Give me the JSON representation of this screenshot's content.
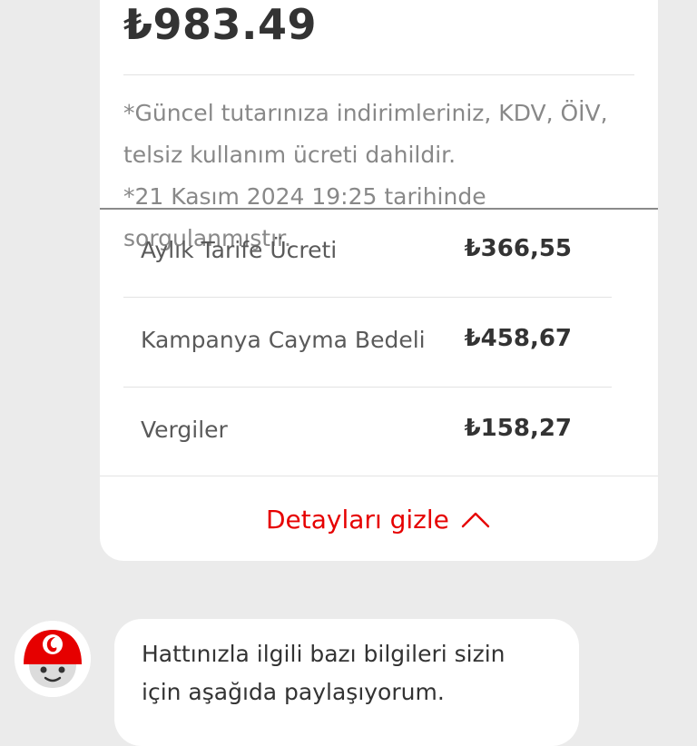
{
  "bill": {
    "total_amount": "₺983.49",
    "note_line1": "*Güncel tutarınıza indirimleriniz, KDV, ÖİV,",
    "note_line2": "telsiz kullanım ücreti dahildir.",
    "note_line3": "*21 Kasım 2024 19:25  tarihinde",
    "note_line4": "sorgulanmıştır."
  },
  "details": {
    "rows": [
      {
        "label": "Aylık Tarife Ücreti",
        "amount": "₺366,55"
      },
      {
        "label": "Kampanya Cayma Bedeli",
        "amount": "₺458,67"
      },
      {
        "label": "Vergiler",
        "amount": "₺158,27"
      }
    ],
    "toggle_label": "Detayları gizle"
  },
  "chat": {
    "message_line1": "Hattınızla ilgili bazı bilgileri sizin",
    "message_line2": "için aşağıda paylaşıyorum."
  },
  "colors": {
    "accent": "#e60000",
    "background": "#ebebeb",
    "card": "#ffffff"
  },
  "icons": {
    "toggle": "chevron-up-icon",
    "avatar": "assistant-avatar-icon"
  }
}
